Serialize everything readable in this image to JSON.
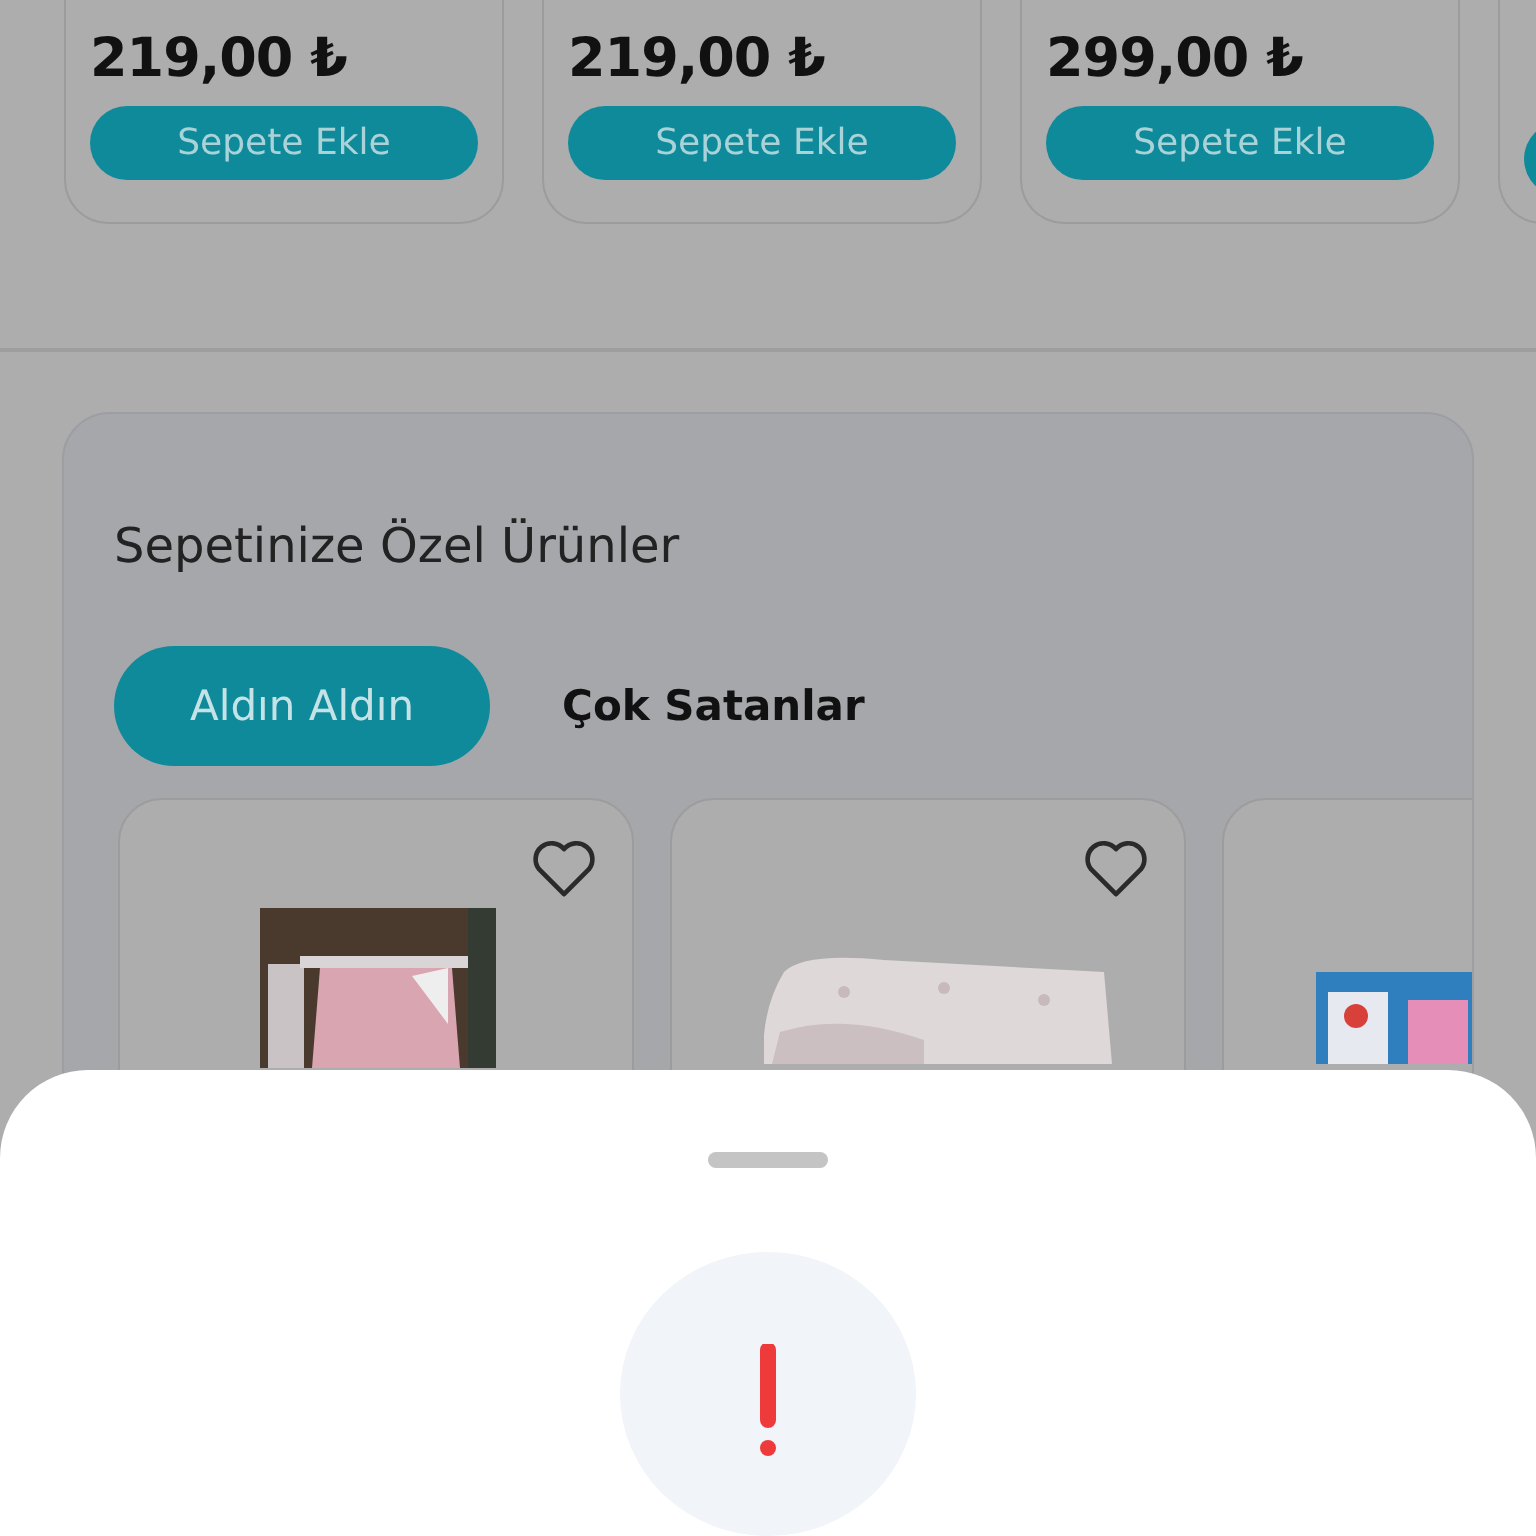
{
  "top_products": [
    {
      "price": "219,00 ₺",
      "button": "Sepete Ekle"
    },
    {
      "price": "219,00 ₺",
      "button": "Sepete Ekle"
    },
    {
      "price": "299,00 ₺",
      "button": "Sepete Ekle"
    }
  ],
  "section": {
    "title": "Sepetinize Özel Ürünler",
    "tabs": [
      {
        "label": "Aldın Aldın",
        "selected": true
      },
      {
        "label": "Çok Satanlar",
        "selected": false
      }
    ],
    "products": [
      {
        "kind": "picture",
        "favorite_button": true
      },
      {
        "kind": "picture",
        "favorite_button": true
      },
      {
        "kind": "picture"
      }
    ]
  }
}
